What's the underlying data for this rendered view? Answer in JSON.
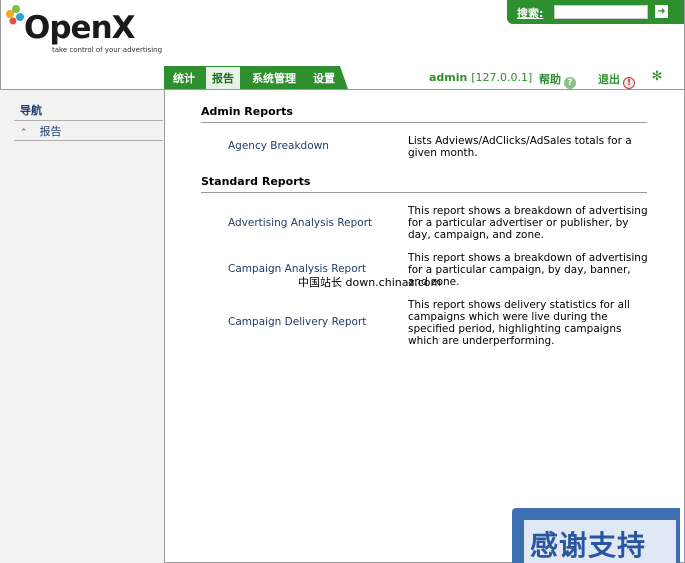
{
  "brand": {
    "name": "OpenX",
    "tagline": "take control of your advertising"
  },
  "search": {
    "label": "搜索:",
    "value": "",
    "go": "➜"
  },
  "tabs": [
    {
      "label": "统计",
      "active": false
    },
    {
      "label": "报告",
      "active": true
    },
    {
      "label": "系统管理",
      "active": false
    },
    {
      "label": "设置",
      "active": false
    }
  ],
  "user": {
    "name": "admin",
    "ip": "[127.0.0.1]",
    "help": "帮助",
    "logout": "退出"
  },
  "sidebar": {
    "title": "导航",
    "items": [
      {
        "label": "报告"
      }
    ]
  },
  "sections": [
    {
      "title": "Admin Reports",
      "reports": [
        {
          "name": "Agency Breakdown",
          "desc": "Lists Adviews/AdClicks/AdSales totals for a given month."
        }
      ]
    },
    {
      "title": "Standard Reports",
      "reports": [
        {
          "name": "Advertising Analysis Report",
          "desc": "This report shows a breakdown of advertising for a particular advertiser or publisher, by day, campaign, and zone."
        },
        {
          "name": "Campaign Analysis Report",
          "desc": "This report shows a breakdown of advertising for a particular campaign, by day, banner, and zone."
        },
        {
          "name": "Campaign Delivery Report",
          "desc": "This report shows delivery statistics for all campaigns which were live during the specified period, highlighting campaigns which are underperforming."
        }
      ]
    }
  ],
  "watermark": {
    "text": "中国站长 down.chinaz.com"
  },
  "banner": {
    "text": "感谢支持"
  },
  "colors": {
    "accent": "#2d8f2d",
    "link": "#1e3d6b",
    "sidebar_bg": "#f2f2f2"
  }
}
